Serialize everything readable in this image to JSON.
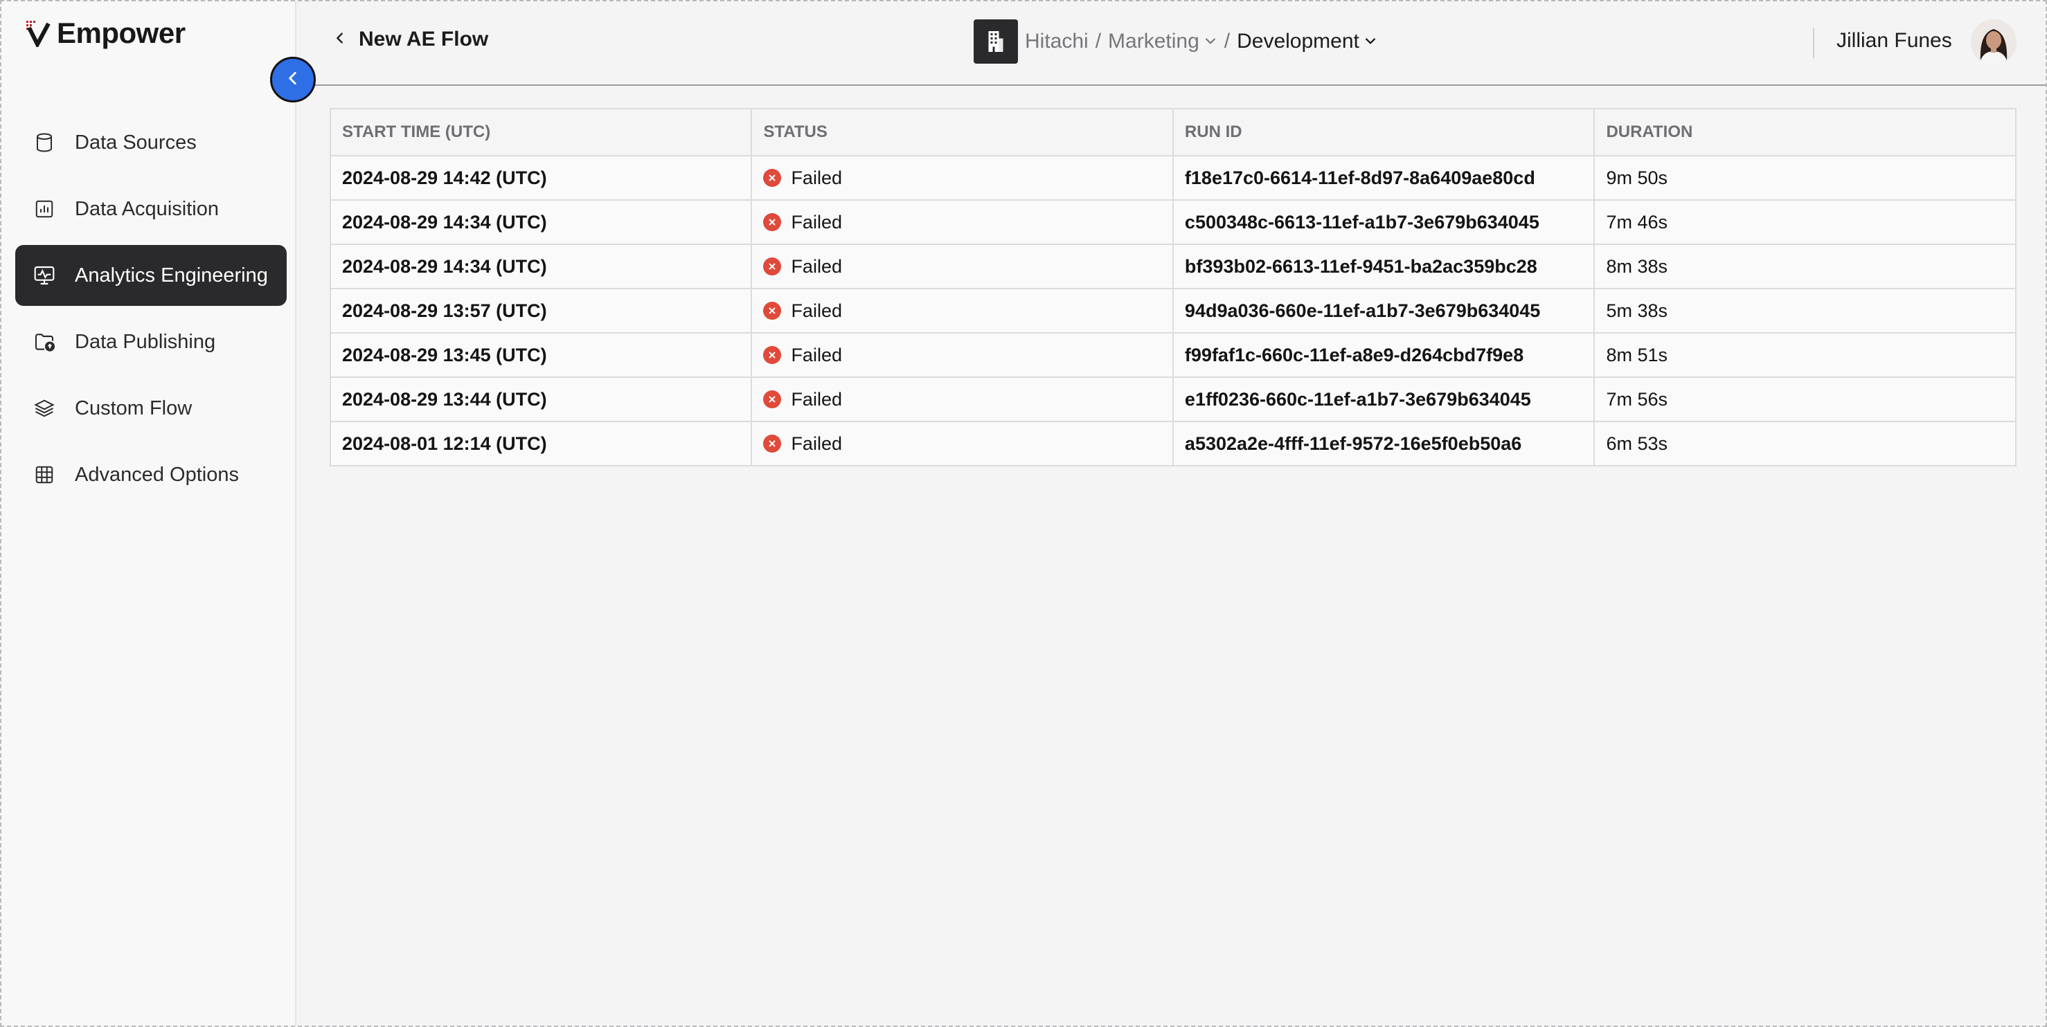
{
  "brand": {
    "name": "Empower"
  },
  "sidebar": {
    "items": [
      {
        "label": "Data Sources",
        "icon": "database-icon"
      },
      {
        "label": "Data Acquisition",
        "icon": "chart-icon"
      },
      {
        "label": "Analytics Engineering",
        "icon": "monitor-pulse-icon",
        "active": true
      },
      {
        "label": "Data Publishing",
        "icon": "folder-upload-icon"
      },
      {
        "label": "Custom Flow",
        "icon": "layers-icon"
      },
      {
        "label": "Advanced Options",
        "icon": "grid-icon"
      }
    ]
  },
  "header": {
    "back_label": "New AE Flow",
    "breadcrumb": {
      "org": "Hitachi",
      "team": "Marketing",
      "env": "Development",
      "separator": "/"
    },
    "user": {
      "name": "Jillian Funes"
    }
  },
  "table": {
    "columns": [
      "START TIME (UTC)",
      "STATUS",
      "RUN ID",
      "DURATION"
    ],
    "rows": [
      {
        "start": "2024-08-29 14:42 (UTC)",
        "status": "Failed",
        "run_id": "f18e17c0-6614-11ef-8d97-8a6409ae80cd",
        "duration": "9m 50s"
      },
      {
        "start": "2024-08-29 14:34 (UTC)",
        "status": "Failed",
        "run_id": "c500348c-6613-11ef-a1b7-3e679b634045",
        "duration": "7m 46s"
      },
      {
        "start": "2024-08-29 14:34 (UTC)",
        "status": "Failed",
        "run_id": "bf393b02-6613-11ef-9451-ba2ac359bc28",
        "duration": "8m 38s"
      },
      {
        "start": "2024-08-29 13:57 (UTC)",
        "status": "Failed",
        "run_id": "94d9a036-660e-11ef-a1b7-3e679b634045",
        "duration": "5m 38s"
      },
      {
        "start": "2024-08-29 13:45 (UTC)",
        "status": "Failed",
        "run_id": "f99faf1c-660c-11ef-a8e9-d264cbd7f9e8",
        "duration": "8m 51s"
      },
      {
        "start": "2024-08-29 13:44 (UTC)",
        "status": "Failed",
        "run_id": "e1ff0236-660c-11ef-a1b7-3e679b634045",
        "duration": "7m 56s"
      },
      {
        "start": "2024-08-01 12:14 (UTC)",
        "status": "Failed",
        "run_id": "a5302a2e-4fff-11ef-9572-16e5f0eb50a6",
        "duration": "6m 53s"
      }
    ]
  },
  "colors": {
    "accent": "#2f6fe6",
    "active_nav": "#2a2a2c",
    "failed": "#e04a3a",
    "brand_red": "#c0202a"
  }
}
